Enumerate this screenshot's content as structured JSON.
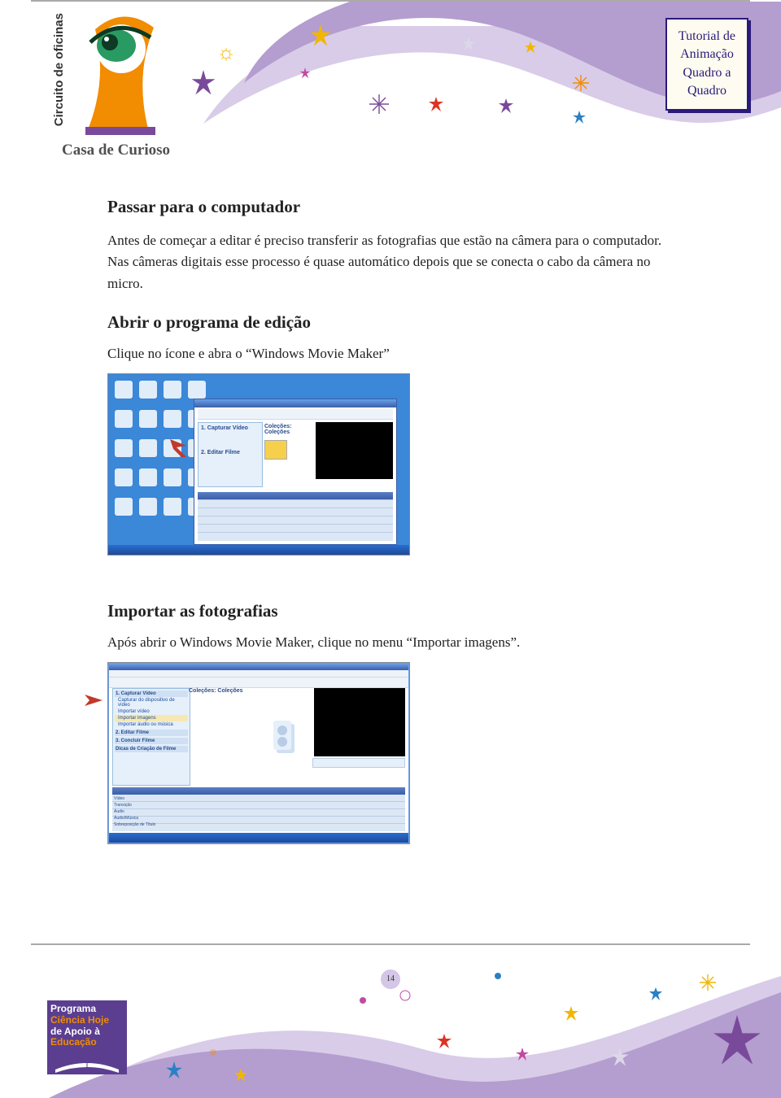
{
  "header": {
    "side_label": "Circuito de oficinas",
    "logo_caption": "Casa de Curioso",
    "title_lines": [
      "Tutorial de",
      "Animação",
      "Quadro a",
      "Quadro"
    ]
  },
  "sections": {
    "s1": {
      "heading": "Passar para o computador",
      "body": "Antes de começar a editar é preciso transferir as fotografias que estão na câmera para o computador.  Nas câmeras digitais esse processo é quase automático depois que se conecta o cabo da câmera no micro."
    },
    "s2": {
      "heading": "Abrir o programa de edição",
      "body": "Clique no ícone e abra o “Windows Movie Maker”"
    },
    "s3": {
      "heading": "Importar as fotografias",
      "body": "Após abrir o Windows Movie Maker, clique no menu “Importar imagens”."
    }
  },
  "wmm": {
    "collections_label": "Coleções: Coleções",
    "task1": "1. Capturar Vídeo",
    "task2": "2. Editar Filme",
    "task3": "3. Concluir Filme",
    "tips": "Dicas de Criação de Filme",
    "tl_labels": [
      "Vídeo",
      "Transição",
      "Áudio",
      "Áudio/Música",
      "Sobreposição de Título"
    ]
  },
  "footer": {
    "page_number": "14",
    "logo_lines": [
      "Programa",
      "Ciência Hoje",
      "de Apoio à",
      "Educação"
    ]
  },
  "colors": {
    "purple": "#b49dcf",
    "lilac": "#d9cce8",
    "navy": "#2a1a7a",
    "orange": "#f28c00"
  }
}
